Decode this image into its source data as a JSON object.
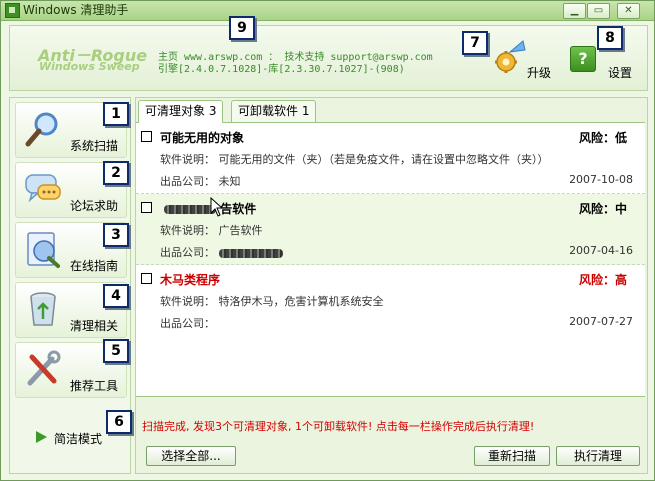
{
  "window": {
    "title": "Windows 清理助手"
  },
  "header": {
    "logo_line1": "Anti－Rogue",
    "logo_line2": "Windows Sweep",
    "info_line1": "主页 www.arswp.com ： 技术支持 support@arswp.com",
    "info_line2": "引擎[2.4.0.7.1028]-库[2.3.30.7.1027]-(908)",
    "upgrade_label": "升级",
    "settings_label": "设置"
  },
  "markers": [
    "1",
    "2",
    "3",
    "4",
    "5",
    "6",
    "7",
    "8",
    "9"
  ],
  "sidebar": {
    "items": [
      {
        "label": "系统扫描",
        "icon": "magnifier-icon"
      },
      {
        "label": "论坛求助",
        "icon": "chat-bubble-icon"
      },
      {
        "label": "在线指南",
        "icon": "globe-guide-icon"
      },
      {
        "label": "清理相关",
        "icon": "recycle-bin-icon"
      },
      {
        "label": "推荐工具",
        "icon": "tools-icon"
      }
    ],
    "simple_mode_label": "简洁模式"
  },
  "tabs": [
    {
      "label": "可清理对象 3",
      "active": true
    },
    {
      "label": "可卸载软件 1",
      "active": false
    }
  ],
  "items": [
    {
      "title": "可能无用的对象",
      "title_color": "#000000",
      "risk": "风险：低",
      "risk_color": "#000000",
      "desc": "软件说明： 可能无用的文件（夹）（若是免疫文件，请在设置中忽略文件（夹））",
      "company": "出品公司： 未知",
      "date": "2007-10-08"
    },
    {
      "title": "告软件",
      "title_color": "#000000",
      "risk": "风险：中",
      "risk_color": "#000000",
      "desc": "软件说明： 广告软件",
      "company": "出品公司：",
      "date": "2007-04-16"
    },
    {
      "title": "木马类程序",
      "title_color": "#cc0000",
      "risk": "风险：高",
      "risk_color": "#cc0000",
      "desc": "软件说明： 特洛伊木马，危害计算机系统安全",
      "company": "出品公司：",
      "date": "2007-07-27"
    }
  ],
  "status_text": "扫描完成, 发现3个可清理对象, 1个可卸载软件! 点击每一栏操作完成后执行清理!",
  "buttons": {
    "select_all": "选择全部...",
    "rescan": "重新扫描",
    "execute": "执行清理"
  },
  "colors": {
    "accent": "#3d9a28",
    "alert": "#d40000",
    "background": "#eef6e4"
  }
}
